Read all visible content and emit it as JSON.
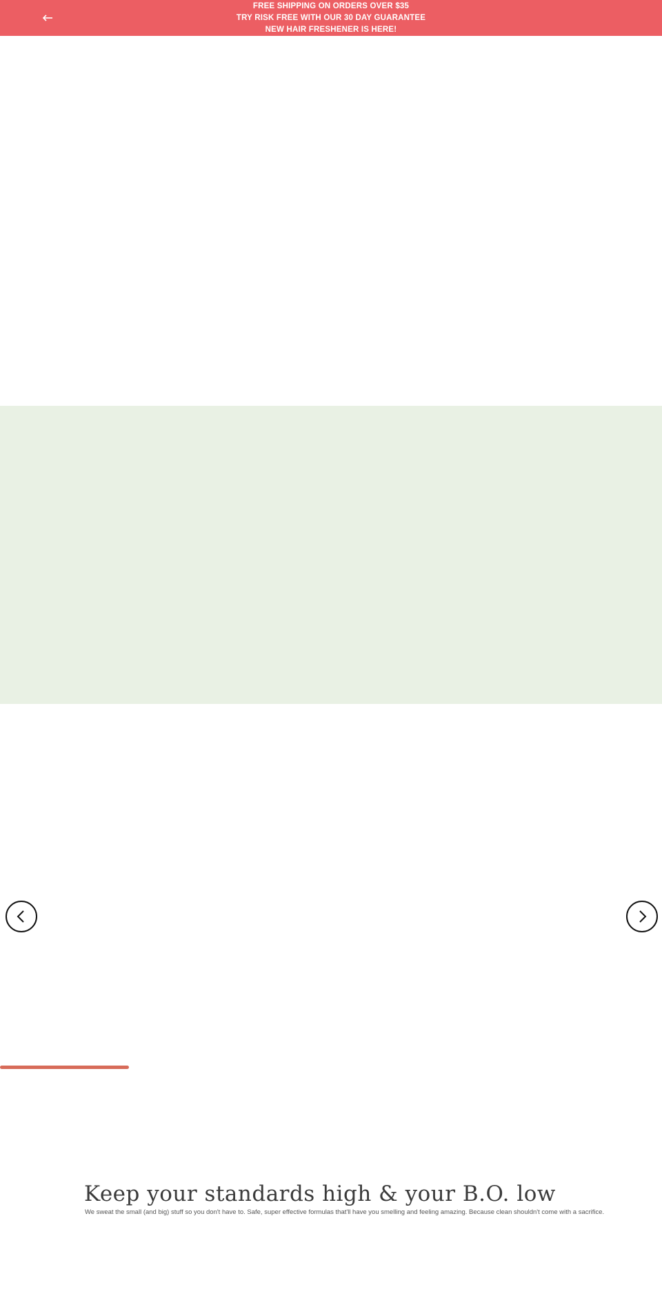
{
  "announcement_bar": {
    "lines": [
      "FREE SHIPPING ON ORDERS OVER $35",
      "TRY RISK FREE WITH OUR 30 DAY GUARANTEE",
      "NEW HAIR FRESHENER IS HERE!"
    ],
    "back_icon": "arrow-left-icon",
    "background_color": "#ec5e63",
    "text_color": "#ffffff"
  },
  "hero": {
    "green_band_color": "#e9f1e4"
  },
  "carousel": {
    "prev_icon": "chevron-left-icon",
    "next_icon": "chevron-right-icon",
    "progress_fraction": 0.195,
    "progress_color": "#d76b59"
  },
  "intro": {
    "headline": "Keep your standards high & your B.O. low",
    "body": "We sweat the small (and big) stuff so you don't have to. Safe, super effective formulas that'll have you smelling and feeling amazing. Because clean shouldn't come with a sacrifice."
  }
}
